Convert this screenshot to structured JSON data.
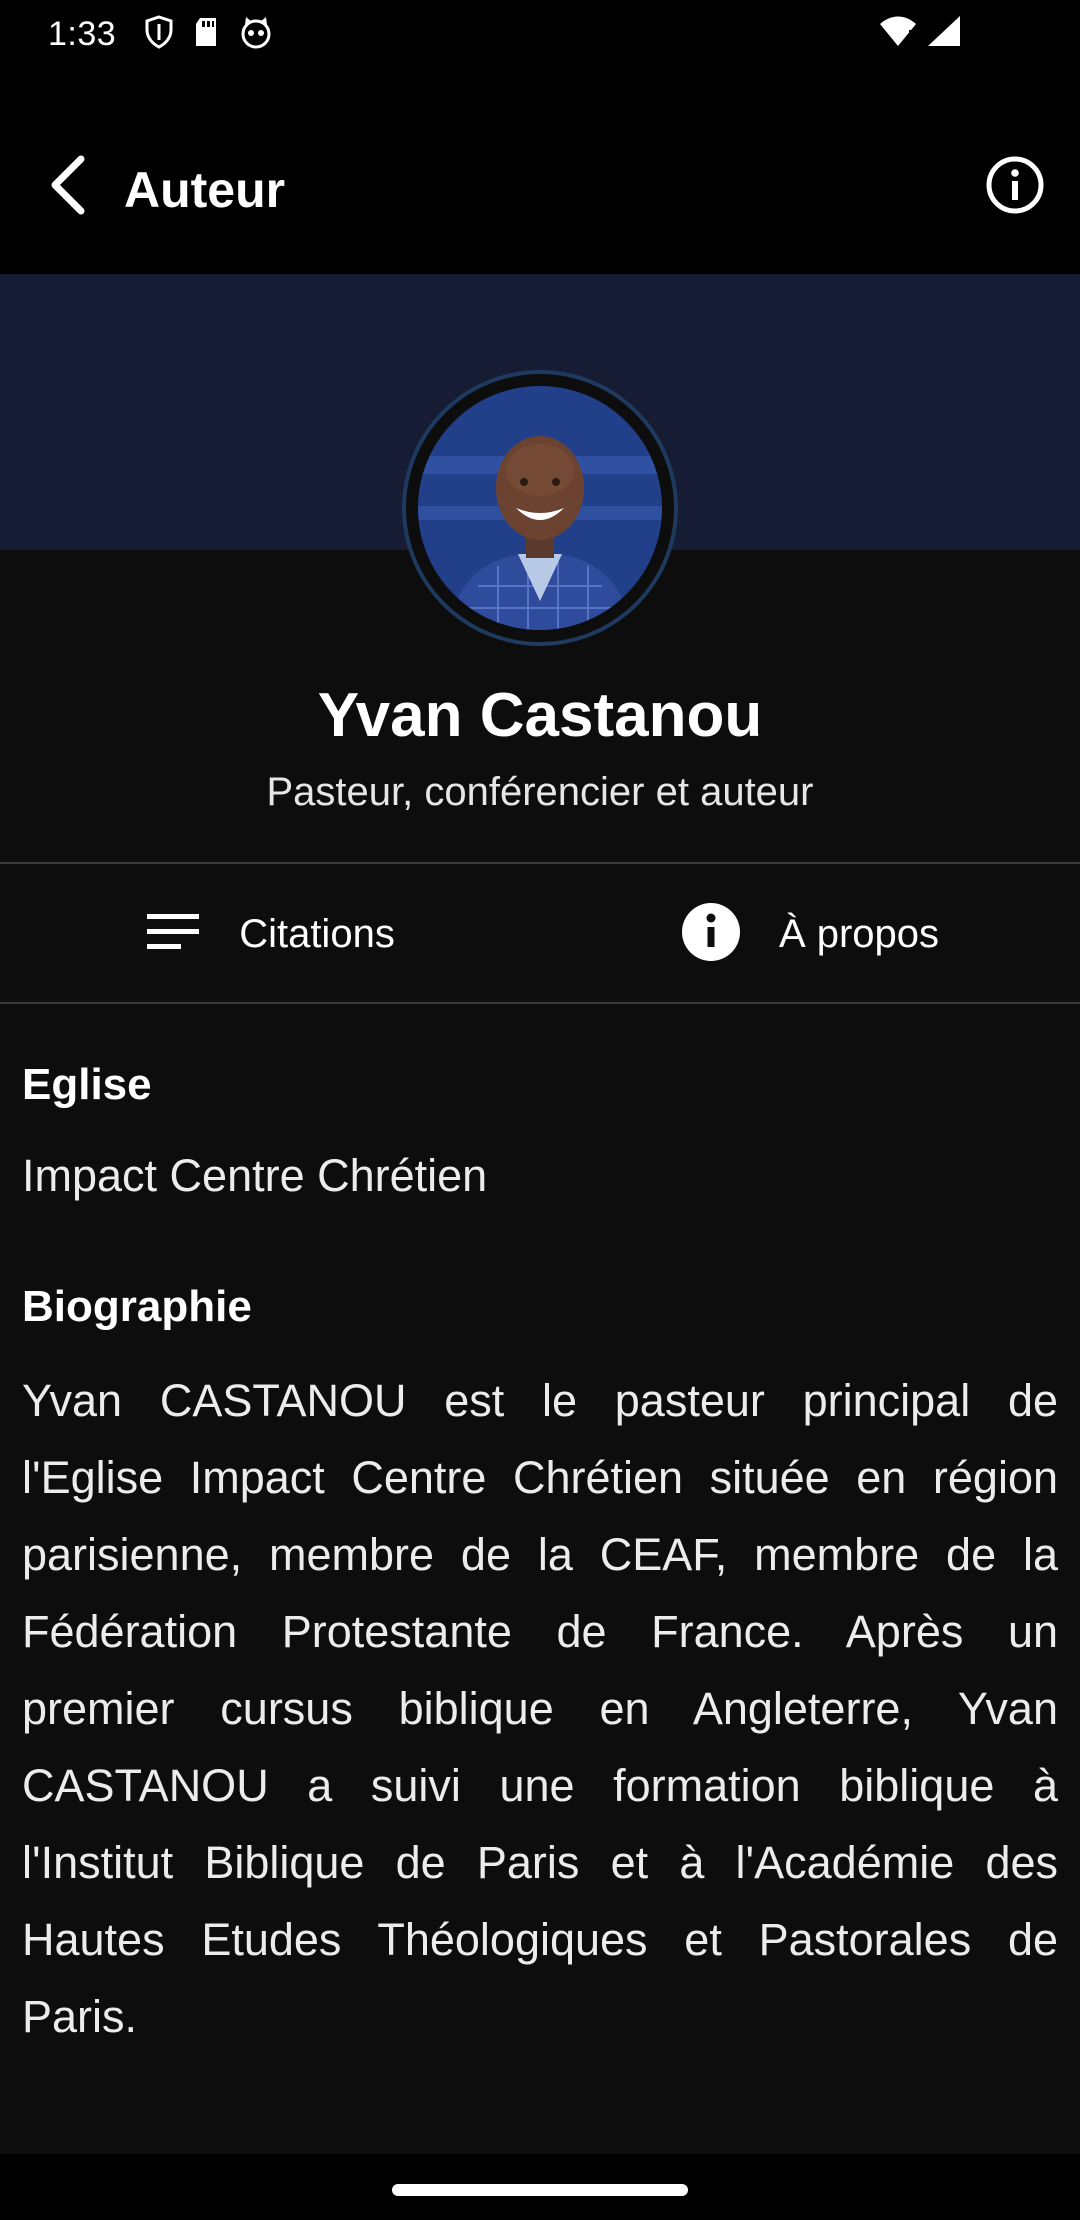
{
  "status_bar": {
    "time": "1:33",
    "icons": [
      "shield-icon",
      "sd-card-icon",
      "cat-icon",
      "wifi-icon",
      "signal-icon"
    ]
  },
  "app_bar": {
    "title": "Auteur",
    "back_icon": "back-arrow-icon",
    "info_icon": "info-outline-icon"
  },
  "author": {
    "name": "Yvan Castanou",
    "subtitle": "Pasteur, conférencier et auteur",
    "avatar_icon": "avatar-photo"
  },
  "tabs": [
    {
      "label": "Citations",
      "icon": "list-icon"
    },
    {
      "label": "À propos",
      "icon": "info-filled-icon"
    }
  ],
  "about": {
    "church_heading": "Eglise",
    "church_value": "Impact Centre Chrétien",
    "bio_heading": "Biographie",
    "bio_text": "Yvan CASTANOU est le pasteur principal de l'Eglise Impact Centre Chrétien située en région parisienne, membre de la CEAF, membre de la Fédération Protestante de France. Après un premier cursus biblique en Angleterre, Yvan CASTANOU a suivi une formation biblique à l'Institut Biblique de Paris et à l'Académie des Hautes Etudes Théologiques et Pastorales de Paris."
  },
  "colors": {
    "background": "#0d0d0d",
    "banner": "#151c33",
    "app_bar": "#000000",
    "divider": "#3a3a3a",
    "avatar_ring": "#1e3a5f"
  }
}
